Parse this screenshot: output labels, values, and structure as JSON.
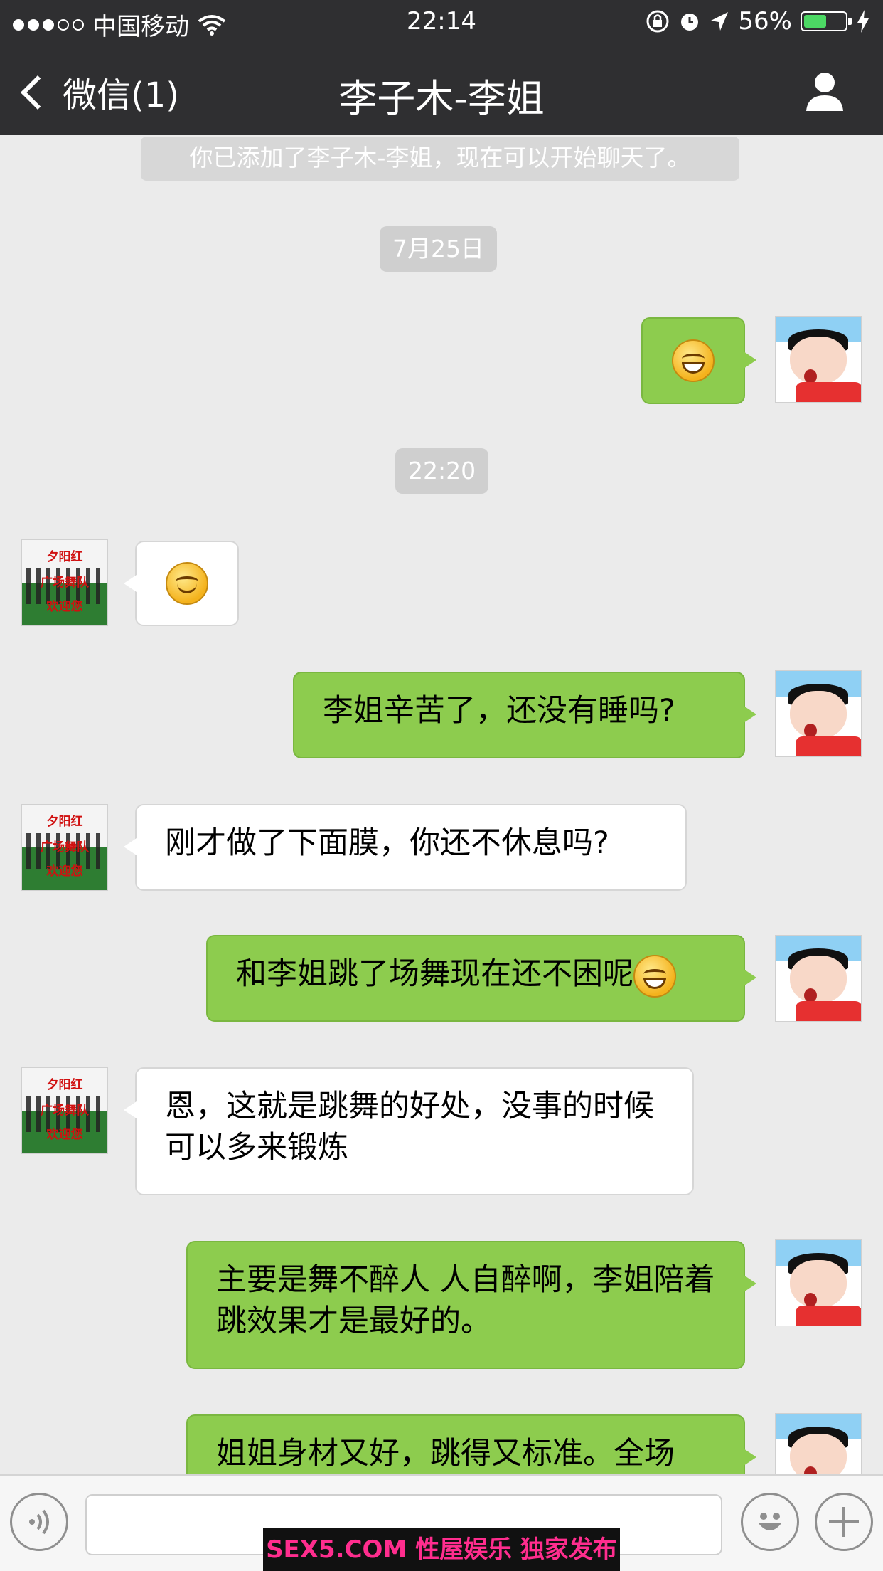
{
  "status_bar": {
    "carrier": "中国移动",
    "time": "22:14",
    "battery": "56%",
    "battery_level": 0.56
  },
  "nav": {
    "back_label": "微信(1)",
    "title": "李子木-李姐"
  },
  "system_notice": "你已添加了李子木-李姐，现在可以开始聊天了。",
  "time_markers": [
    "7月25日",
    "22:20"
  ],
  "contact_avatar_text": [
    "夕阳红",
    "广场舞队",
    "欢迎您"
  ],
  "messages": [
    {
      "from": "me",
      "emoji": "grin"
    },
    {
      "from": "them",
      "emoji": "smile"
    },
    {
      "from": "me",
      "text": "李姐辛苦了，还没有睡吗?"
    },
    {
      "from": "them",
      "text": "刚才做了下面膜，你还不休息吗?"
    },
    {
      "from": "me",
      "text": "和李姐跳了场舞现在还不困呢",
      "emoji": "grin"
    },
    {
      "from": "them",
      "text": "恩，这就是跳舞的好处，没事的时候可以多来锻炼"
    },
    {
      "from": "me",
      "text": "主要是舞不醉人 人自醉啊，李姐陪着跳效果才是最好的。"
    },
    {
      "from": "me",
      "text": "姐姐身材又好，跳得又标准。全场"
    }
  ],
  "watermark": "SEX5.COM 性屋娱乐 独家发布"
}
